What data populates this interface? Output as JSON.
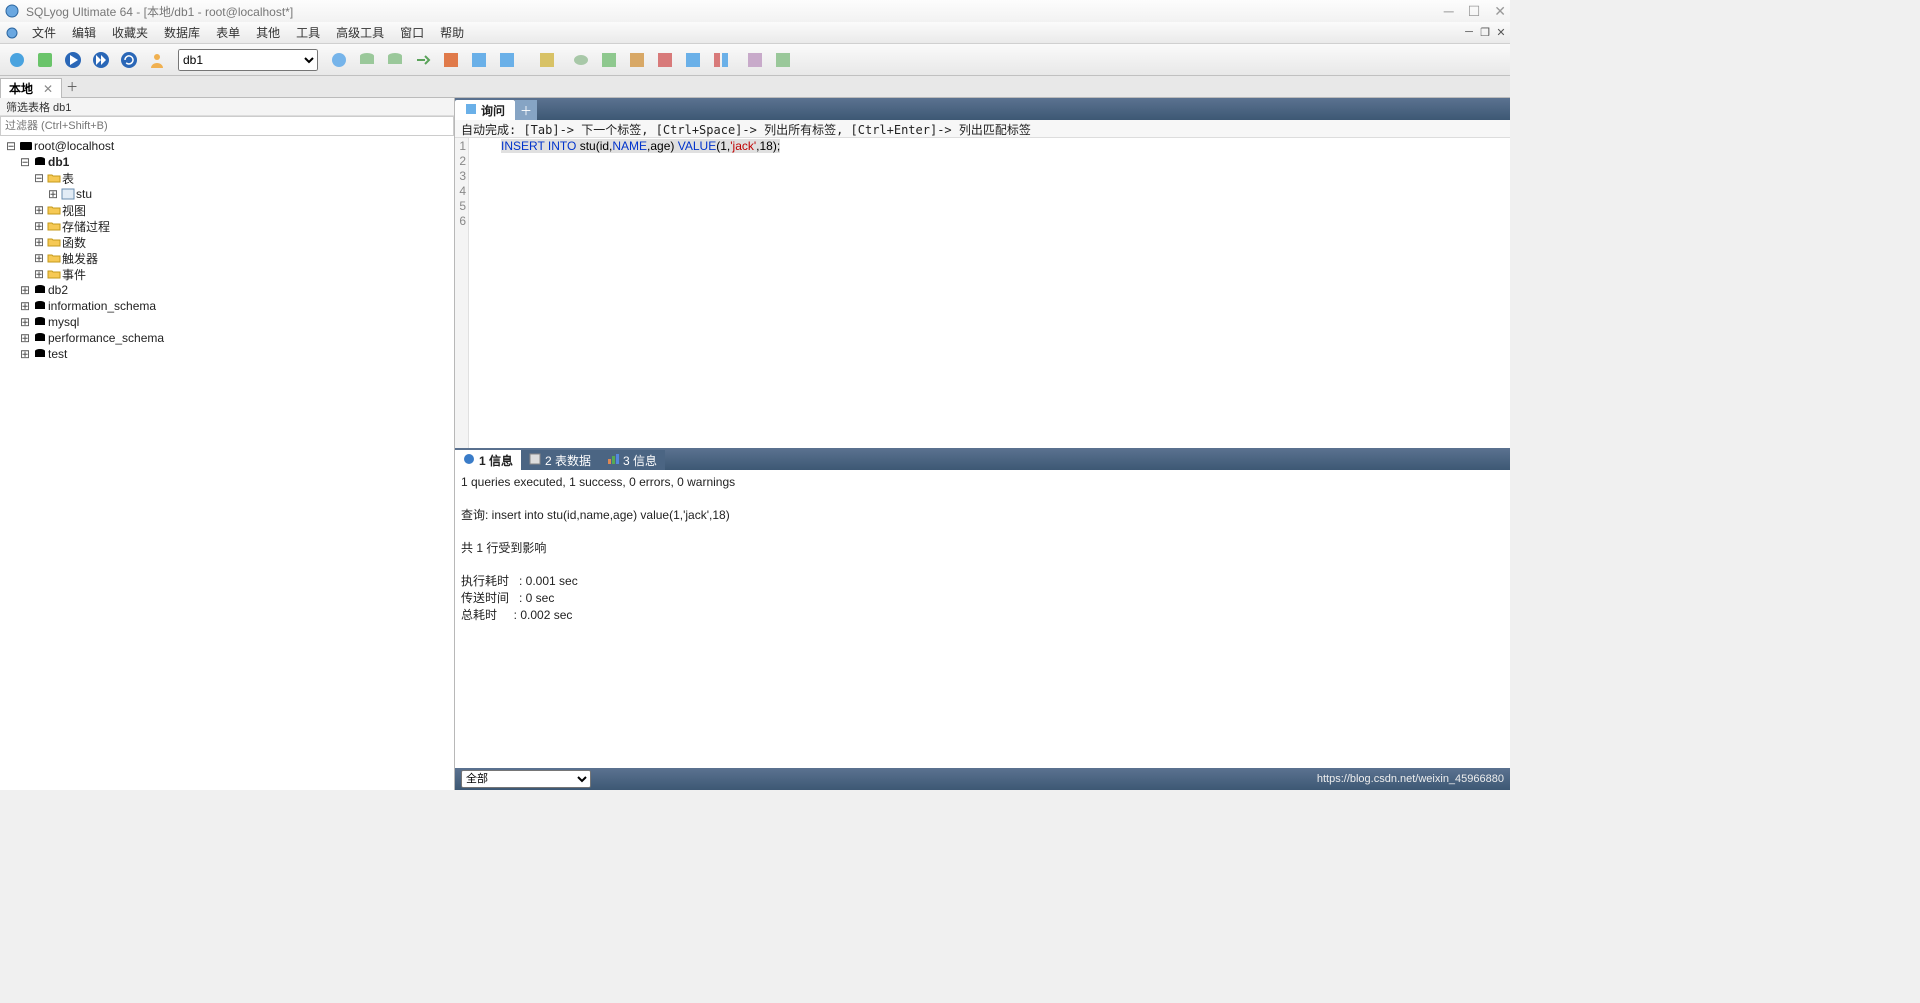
{
  "window": {
    "title": "SQLyog Ultimate 64 - [本地/db1 - root@localhost*]"
  },
  "menu": {
    "items": [
      "文件",
      "编辑",
      "收藏夹",
      "数据库",
      "表单",
      "其他",
      "工具",
      "高级工具",
      "窗口",
      "帮助"
    ]
  },
  "toolbar": {
    "db_selected": "db1"
  },
  "connection_tab": {
    "label": "本地"
  },
  "sidebar": {
    "filter_label": "筛选表格 db1",
    "filter_placeholder": "过滤器 (Ctrl+Shift+B)",
    "root": "root@localhost",
    "db1": "db1",
    "tables": "表",
    "stu": "stu",
    "views": "视图",
    "procs": "存储过程",
    "funcs": "函数",
    "triggers": "触发器",
    "events": "事件",
    "db2": "db2",
    "info": "information_schema",
    "mysql": "mysql",
    "perf": "performance_schema",
    "test": "test"
  },
  "query_tab": {
    "label": "询问"
  },
  "hint": "自动完成: [Tab]-> 下一个标签, [Ctrl+Space]-> 列出所有标签, [Ctrl+Enter]-> 列出匹配标签",
  "sql": {
    "kw_insert": "INSERT INTO",
    "tbl": " stu(id,",
    "name_kw": "NAME",
    "cols2": ",age) ",
    "kw_value": "VALUE",
    "par1": "(",
    "v1": "1",
    "c1": ",",
    "str": "'jack'",
    "c2": ",",
    "v2": "18",
    "par2": ");"
  },
  "gutter_lines": [
    "1",
    "2",
    "3",
    "4",
    "5",
    "6"
  ],
  "result_tabs": {
    "t1": "1 信息",
    "t2": "2 表数据",
    "t3": "3 信息"
  },
  "result": {
    "line1": "1 queries executed, 1 success, 0 errors, 0 warnings",
    "line_query_label": "查询: ",
    "line_query": "insert into stu(id,name,age) value(1,'jack',18)",
    "line_affected": "共 1 行受到影响",
    "exec_label": "执行耗时   : ",
    "exec_val": "0.001 sec",
    "trans_label": "传送时间   : ",
    "trans_val": "0 sec",
    "total_label": "总耗时     : ",
    "total_val": "0.002 sec"
  },
  "status": {
    "filter": "全部",
    "attribution": "https://blog.csdn.net/weixin_45966880"
  }
}
